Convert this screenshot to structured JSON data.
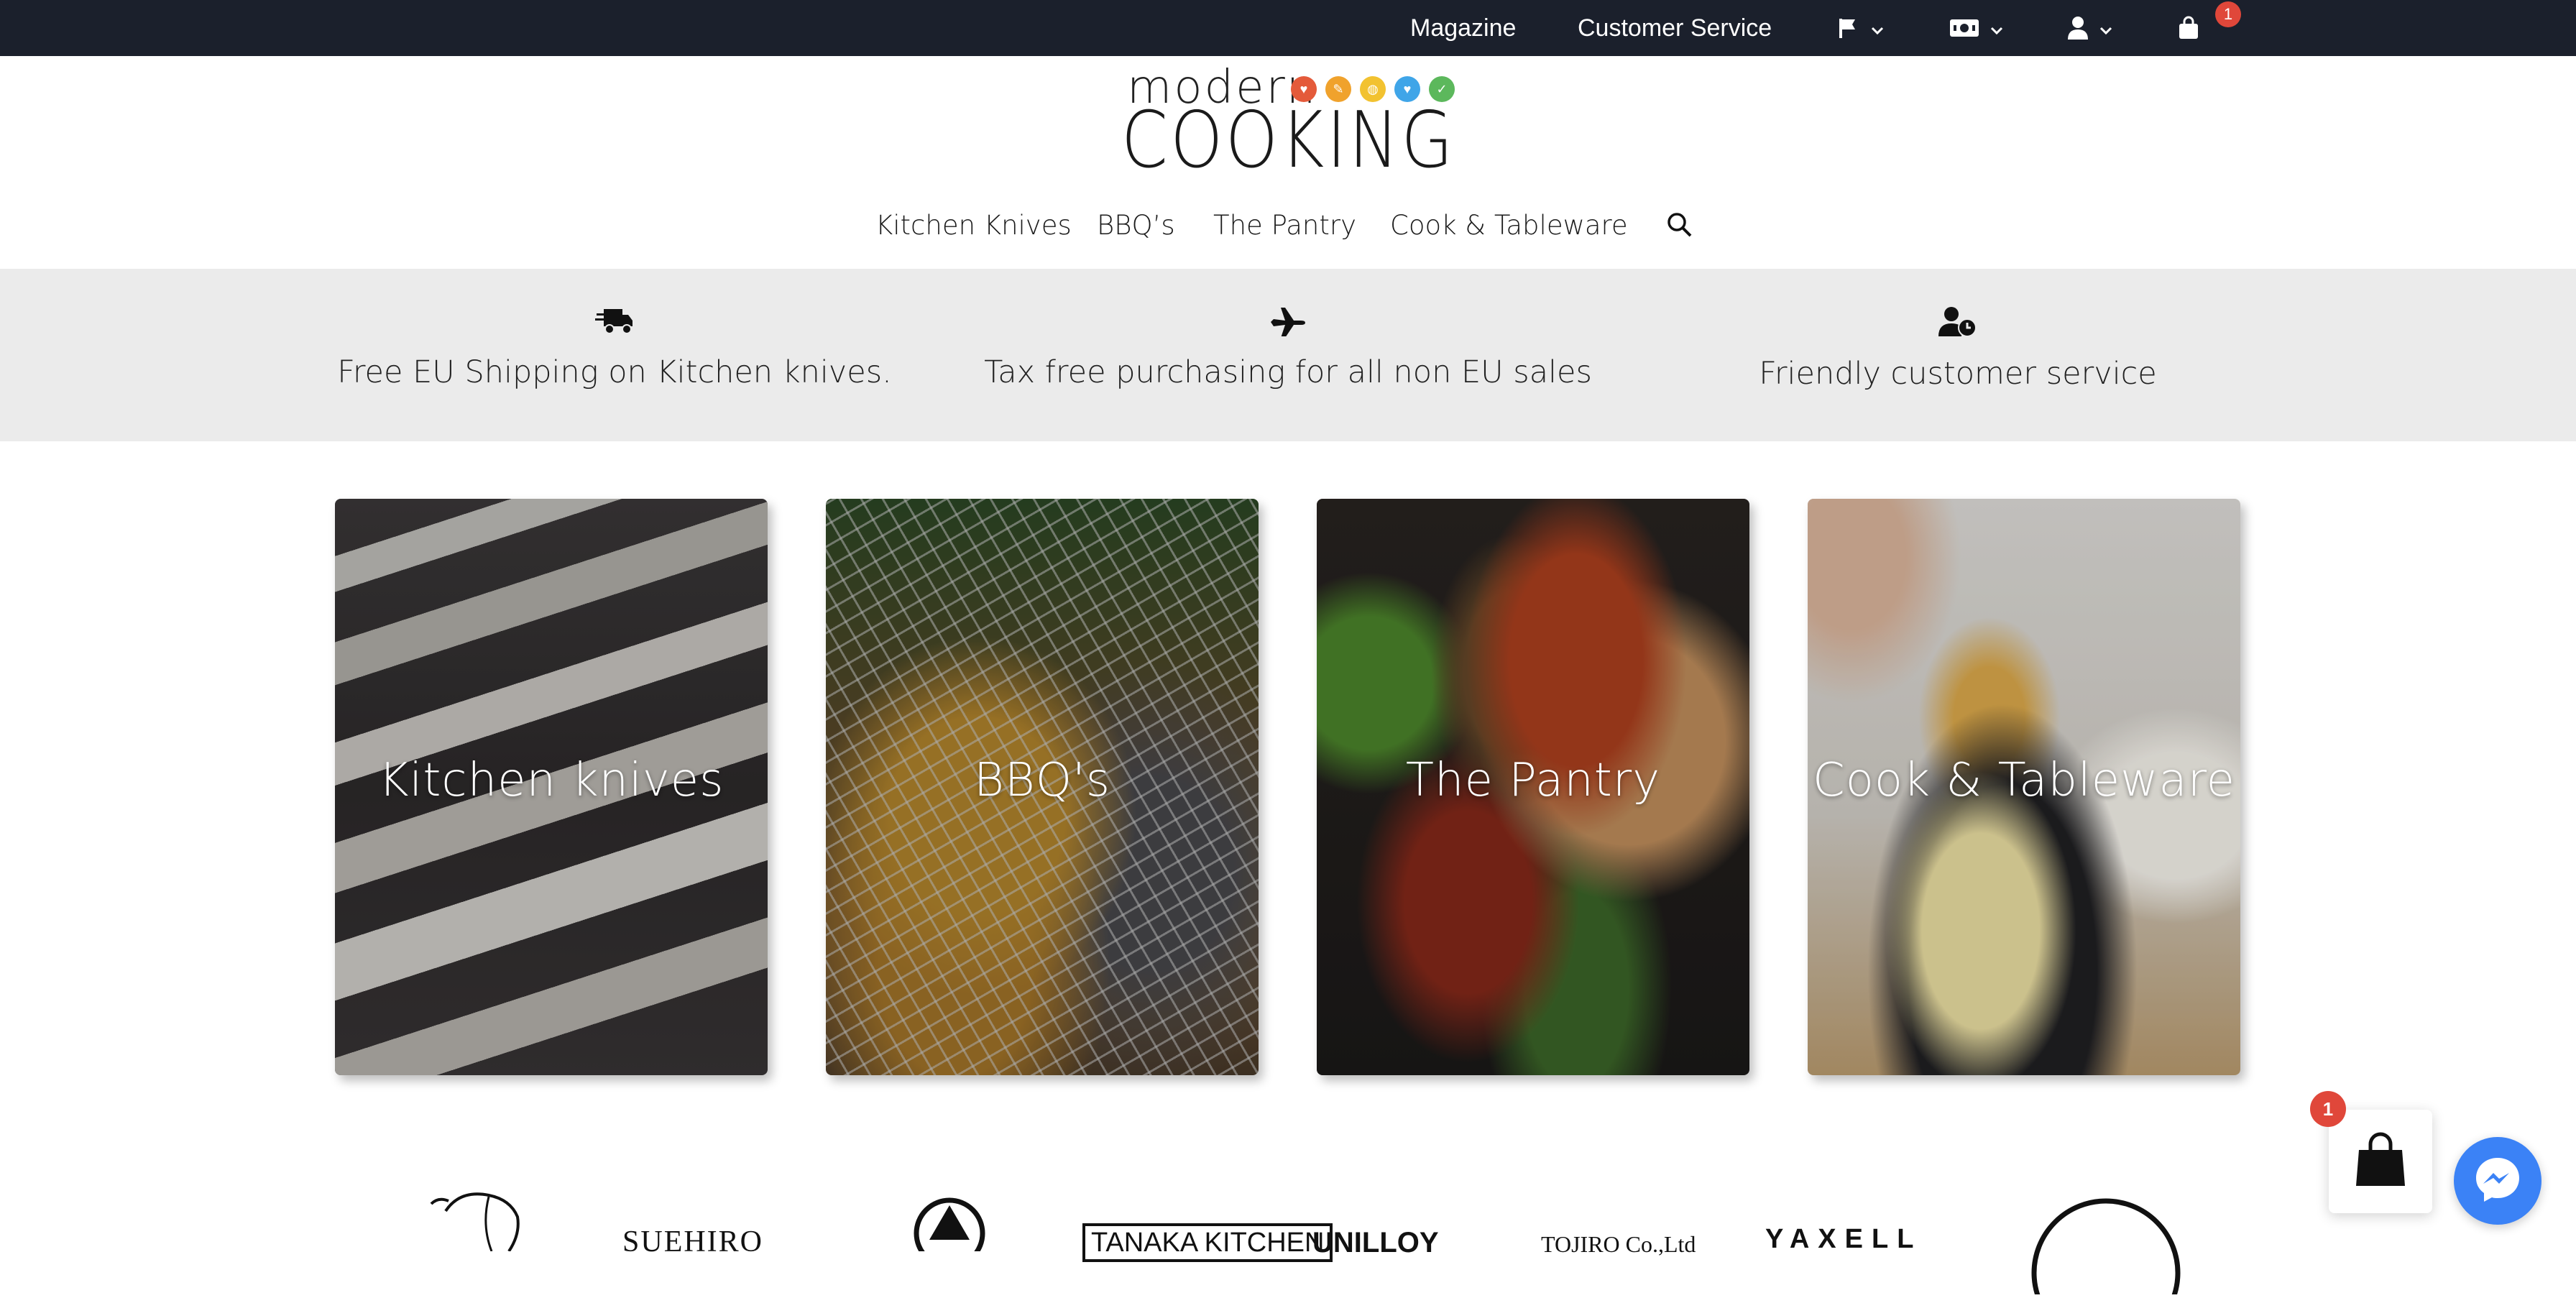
{
  "topbar": {
    "magazine": "Magazine",
    "customer_service": "Customer Service",
    "language_icon": "flag-icon",
    "currency_icon": "money-icon",
    "account_icon": "user-icon",
    "cart_icon": "bag-icon",
    "cart_count": "1"
  },
  "logo": {
    "line1": "modern",
    "line2": "COOKING"
  },
  "nav": {
    "items": [
      "Kitchen Knives",
      "BBQ’s",
      "The Pantry",
      "Cook & Tableware"
    ],
    "search_icon": "search-icon"
  },
  "usp": [
    {
      "icon": "truck-icon",
      "text": "Free EU Shipping on Kitchen knives."
    },
    {
      "icon": "plane-icon",
      "text": "Tax free purchasing for all non EU sales"
    },
    {
      "icon": "user-clock-icon",
      "text": "Friendly customer service"
    }
  ],
  "categories": [
    {
      "label": "Kitchen knives"
    },
    {
      "label": "BBQ's"
    },
    {
      "label": "The Pantry"
    },
    {
      "label": "Cook & Tableware"
    }
  ],
  "brands": [
    "SUEHIRO",
    "TANAKA KITCHEN",
    "UNILLOY",
    "TOJIRO Co.,Ltd",
    "YAXELL"
  ],
  "floating": {
    "cart_count": "1"
  },
  "colors": {
    "topbar_bg": "#1b202c",
    "badge": "#e0473a",
    "usp_bg": "#ebebeb",
    "messenger": "#3b82f6"
  }
}
